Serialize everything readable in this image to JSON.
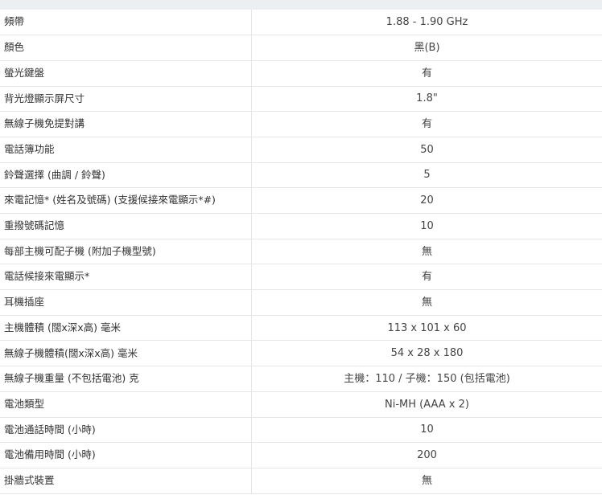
{
  "specs": [
    {
      "label": "頻帶",
      "value": "1.88 - 1.90 GHz"
    },
    {
      "label": "顏色",
      "value": "黑(B)"
    },
    {
      "label": "螢光鍵盤",
      "value": "有"
    },
    {
      "label": "背光燈顯示屏尺寸",
      "value": "1.8\""
    },
    {
      "label": "無線子機免提對講",
      "value": "有"
    },
    {
      "label": "電話簿功能",
      "value": "50"
    },
    {
      "label": "鈴聲選擇 (曲調 / 鈴聲)",
      "value": "5"
    },
    {
      "label": "來電記憶* (姓名及號碼) (支援候接來電顯示*#)",
      "value": "20"
    },
    {
      "label": "重撥號碼記憶",
      "value": "10"
    },
    {
      "label": "每部主機可配子機 (附加子機型號)",
      "value": "無"
    },
    {
      "label": "電話候接來電顯示*",
      "value": "有"
    },
    {
      "label": "耳機插座",
      "value": "無"
    },
    {
      "label": "主機體積 (闊x深x高) 毫米",
      "value": "113 x 101 x 60"
    },
    {
      "label": "無線子機體積(闊x深x高) 毫米",
      "value": "54 x 28 x 180"
    },
    {
      "label": "無線子機重量 (不包括電池) 克",
      "value": "主機：110 / 子機：150 (包括電池)"
    },
    {
      "label": "電池類型",
      "value": "Ni-MH (AAA x 2)"
    },
    {
      "label": "電池通話時間 (小時)",
      "value": "10"
    },
    {
      "label": "電池備用時間 (小時)",
      "value": "200"
    },
    {
      "label": "掛牆式裝置",
      "value": "無"
    }
  ]
}
